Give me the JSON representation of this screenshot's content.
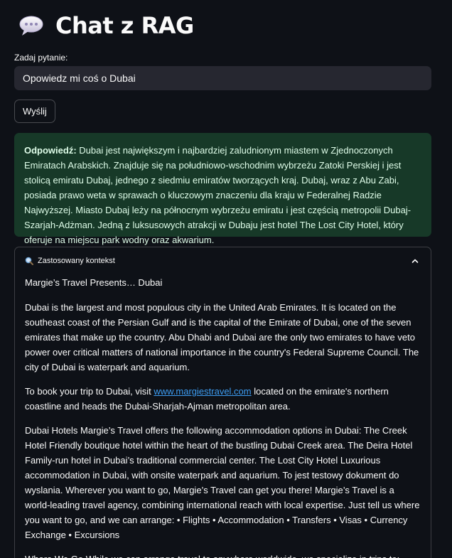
{
  "app": {
    "title": "Chat z RAG",
    "title_icon": "speech-bubble-icon"
  },
  "form": {
    "label": "Zadaj pytanie:",
    "value": "Opowiedz mi coś o Dubai",
    "send_label": "Wyślij"
  },
  "answer": {
    "prefix": "Odpowiedź:",
    "text": " Dubai jest największym i najbardziej zaludnionym miastem w Zjednoczonych Emiratach Arabskich. Znajduje się na południowo-wschodnim wybrzeżu Zatoki Perskiej i jest stolicą emiratu Dubaj, jednego z siedmiu emiratów tworzących kraj. Dubaj, wraz z Abu Zabi, posiada prawo weta w sprawach o kluczowym znaczeniu dla kraju w Federalnej Radzie Najwyższej. Miasto Dubaj leży na północnym wybrzeżu emiratu i jest częścią metropolii Dubaj-Szarjah-Adżman. Jedną z luksusowych atrakcji w Dubaju jest hotel The Lost City Hotel, który oferuje na miejscu park wodny oraz akwarium.",
    "color": "#173928"
  },
  "context": {
    "title": "Zastosowany kontekst",
    "icon": "magnifier-icon",
    "heading": "Margie’s Travel Presents… Dubai",
    "p1": "Dubai is the largest and most populous city in the United Arab Emirates. It is located on the southeast coast of the Persian Gulf and is the capital of the Emirate of Dubai, one of the seven emirates that make up the country. Abu Dhabi and Dubai are the only two emirates to have veto power over critical matters of national importance in the country's Federal Supreme Council. The city of Dubai is waterpark and aquarium.",
    "p2_before": "To book your trip to Dubai, visit ",
    "p2_link": "www.margiestravel.com",
    "p2_after": " located on the emirate's northern coastline and heads the Dubai-Sharjah-Ajman metropolitan area.",
    "p3": "Dubai Hotels Margie’s Travel offers the following accommodation options in Dubai: The Creek Hotel Friendly boutique hotel within the heart of the bustling Dubai Creek area. The Deira Hotel Family-run hotel in Dubai’s traditional commercial center. The Lost City Hotel Luxurious accommodation in Dubai, with onsite waterpark and aquarium. To jest testowy dokument do wyslania. Wherever you want to go, Margie’s Travel can get you there! Margie’s Travel is a world-leading travel agency, combining international reach with local expertise. Just tell us where you want to go, and we can arrange: • Flights • Accommodation • Transfers • Visas • Currency Exchange • Excursions",
    "p4": "Where We Go While we can arrange travel to anywhere worldwide, we specialize in trips to: • Dubai •"
  }
}
